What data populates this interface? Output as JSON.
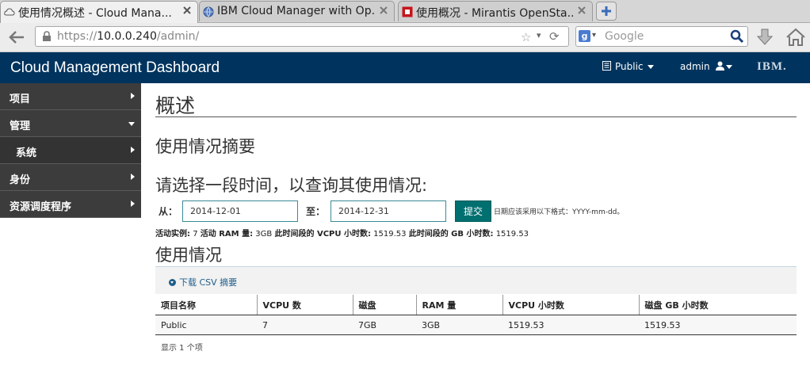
{
  "browser": {
    "tabs": [
      {
        "title": "使用情况概述 - Cloud Mana...",
        "active": true
      },
      {
        "title": "IBM Cloud Manager with Op...",
        "active": false
      },
      {
        "title": "使用概况 - Mirantis OpenSta...",
        "active": false
      }
    ],
    "url_prefix": "https://",
    "url_host": "10.0.0.240",
    "url_path": "/admin/",
    "search_placeholder": "Google"
  },
  "header": {
    "title": "Cloud Management Dashboard",
    "project": "Public",
    "user": "admin",
    "logo_text": "IBM."
  },
  "sidebar": {
    "items": [
      {
        "label": "项目"
      },
      {
        "label": "管理"
      },
      {
        "label": "系统"
      },
      {
        "label": "身份"
      },
      {
        "label": "资源调度程序"
      }
    ]
  },
  "main": {
    "title": "概述",
    "summary_heading": "使用情况摘要",
    "period_heading": "请选择一段时间，以查询其使用情况:",
    "from_label": "从：",
    "start_date": "2014-12-01",
    "to_label": "至：",
    "end_date": "2014-12-31",
    "submit_label": "提交",
    "date_hint": "日期应该采用以下格式：YYYY-mm-dd。",
    "stats": {
      "instances_label": "活动实例:",
      "instances": "7",
      "ram_label": "活动 RAM 量:",
      "ram": "3GB",
      "vcpu_hours_label": "此时间段的 VCPU 小时数:",
      "vcpu_hours": "1519.53",
      "gb_hours_label": "此时间段的 GB 小时数:",
      "gb_hours": "1519.53"
    },
    "usage_heading": "使用情况",
    "csv_link": "下载 CSV 摘要",
    "table": {
      "headers": [
        "项目名称",
        "VCPU 数",
        "磁盘",
        "RAM 量",
        "VCPU 小时数",
        "磁盘 GB 小时数"
      ],
      "rows": [
        [
          "Public",
          "7",
          "7GB",
          "3GB",
          "1519.53",
          "1519.53"
        ]
      ],
      "footer": "显示 1 个项"
    }
  },
  "colors": {
    "header_bg": "#00345e",
    "sidebar_bg": "#3c3c3c",
    "submit_bg": "#006f70",
    "link": "#1f5d8a"
  }
}
